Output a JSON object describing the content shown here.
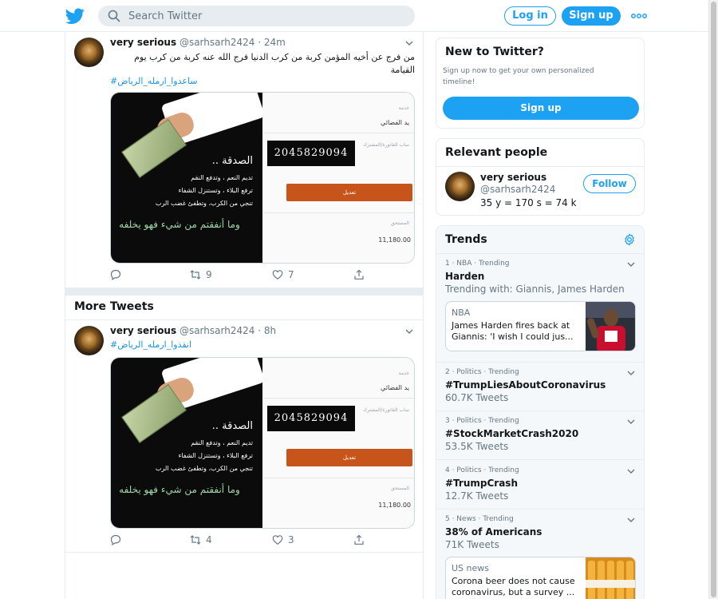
{
  "topbar": {
    "search_placeholder": "Search Twitter",
    "login_label": "Log in",
    "signup_label": "Sign up"
  },
  "main": {
    "tweets": [
      {
        "name": "very serious",
        "handle": "@sarhsarh2424",
        "time": "· 24m",
        "text": "من فرج عن أخيه المؤمن كربة من كرب الدنيا فرج الله عنه كربة من كرب يوم القيامة",
        "hashtag": "#ساعدوا_ارمله_الرياض",
        "media": {
          "title": "الصدقة ..",
          "line1": "تديم النعم ، وتدفع النقم",
          "line2": "ترفع البلاء ، وتستنزل الشفاء",
          "line3": "تنجي من الكرب، وتطفئ غضب الرب",
          "verse": "وما أنفقتم من شيء فهو يخلفه",
          "number": "2045829094",
          "button": "تعديل",
          "amount": "11,180.00",
          "label_service": "خدمة",
          "label_name": "يد الفضائي",
          "label_account": "ساب الفاتورة/المشترك",
          "label_due": "المستحق"
        },
        "replies": "",
        "retweets": "9",
        "likes": "7"
      },
      {
        "name": "very serious",
        "handle": "@sarhsarh2424",
        "time": "· 8h",
        "hashtag": "#انقذوا_ارمله_الرياض",
        "media": {
          "title": "الصدقة ..",
          "line1": "تديم النعم ، وتدفع النقم",
          "line2": "ترفع البلاء ، وتستنزل الشفاء",
          "line3": "تنجي من الكرب، وتطفئ غضب الرب",
          "verse": "وما أنفقتم من شيء فهو يخلفه",
          "number": "2045829094",
          "button": "تعديل",
          "amount": "11,180.00",
          "label_service": "خدمة",
          "label_name": "يد الفضائي",
          "label_account": "ساب الفاتورة/المشترك",
          "label_due": "المستحق"
        },
        "replies": "",
        "retweets": "4",
        "likes": "3"
      }
    ],
    "more_tweets_title": "More Tweets"
  },
  "sidebar": {
    "new_to_twitter": {
      "title": "New to Twitter?",
      "subtitle": "Sign up now to get your own personalized timeline!",
      "signup_label": "Sign up"
    },
    "relevant_people": {
      "title": "Relevant people",
      "name": "very serious",
      "handle": "@sarhsarh2424",
      "bio": "35 y = 170 s = 74 k",
      "follow_label": "Follow"
    },
    "trends": {
      "title": "Trends",
      "items": [
        {
          "meta": "1 · NBA · Trending",
          "name": "Harden",
          "sub": "Trending with: Giannis, James Harden",
          "news_source": "NBA",
          "news_headline": "James Harden fires back at Giannis: 'I wish I could jus..."
        },
        {
          "meta": "2 · Politics · Trending",
          "name": "#TrumpLiesAboutCoronavirus",
          "sub": "60.7K Tweets"
        },
        {
          "meta": "3 · Politics · Trending",
          "name": "#StockMarketCrash2020",
          "sub": "53.5K Tweets"
        },
        {
          "meta": "4 · Politics · Trending",
          "name": "#TrumpCrash",
          "sub": "12.7K Tweets"
        },
        {
          "meta": "5 · News · Trending",
          "name": "38% of Americans",
          "sub": "71K Tweets",
          "news_source": "US news",
          "news_headline": "Corona beer does not cause coronavirus, but a survey ..."
        }
      ]
    }
  },
  "colors": {
    "accent": "#1da1f2",
    "text": "#14171a",
    "muted": "#657786",
    "border": "#e6ecf0"
  },
  "icons": {
    "logo": "twitter-bird-icon",
    "search": "search-icon",
    "more": "more-dots-icon",
    "reply": "reply-icon",
    "retweet": "retweet-icon",
    "like": "heart-icon",
    "share": "share-icon",
    "caret": "chevron-down-icon",
    "settings": "gear-icon"
  }
}
